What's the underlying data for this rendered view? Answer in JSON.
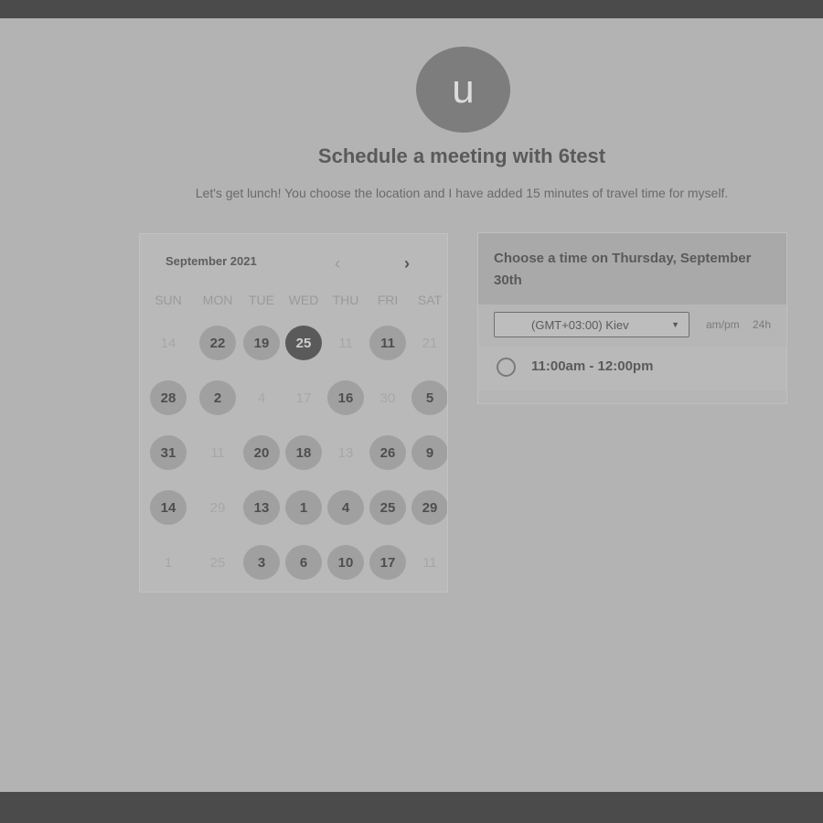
{
  "host": {
    "avatar_initial": "u",
    "title": "Schedule a meeting with 6test",
    "description": "Let's get lunch! You choose the location and I have added 15 minutes of travel time for myself."
  },
  "calendar": {
    "month_label": "September 2021",
    "prev_icon": "chevron-left-icon",
    "next_icon": "chevron-right-icon",
    "weekdays": [
      "SUN",
      "MON",
      "TUE",
      "WED",
      "THU",
      "FRI",
      "SAT"
    ],
    "weeks": [
      [
        {
          "label": "14",
          "state": "off"
        },
        {
          "label": "22",
          "state": "on"
        },
        {
          "label": "19",
          "state": "on"
        },
        {
          "label": "25",
          "state": "selected"
        },
        {
          "label": "11",
          "state": "off"
        },
        {
          "label": "11",
          "state": "on"
        },
        {
          "label": "21",
          "state": "off"
        }
      ],
      [
        {
          "label": "28",
          "state": "on"
        },
        {
          "label": "2",
          "state": "on"
        },
        {
          "label": "4",
          "state": "off"
        },
        {
          "label": "17",
          "state": "off"
        },
        {
          "label": "16",
          "state": "on"
        },
        {
          "label": "30",
          "state": "off"
        },
        {
          "label": "5",
          "state": "on"
        }
      ],
      [
        {
          "label": "31",
          "state": "on"
        },
        {
          "label": "11",
          "state": "off"
        },
        {
          "label": "20",
          "state": "on"
        },
        {
          "label": "18",
          "state": "on"
        },
        {
          "label": "13",
          "state": "off"
        },
        {
          "label": "26",
          "state": "on"
        },
        {
          "label": "9",
          "state": "on"
        }
      ],
      [
        {
          "label": "14",
          "state": "on"
        },
        {
          "label": "29",
          "state": "off"
        },
        {
          "label": "13",
          "state": "on"
        },
        {
          "label": "1",
          "state": "on"
        },
        {
          "label": "4",
          "state": "on"
        },
        {
          "label": "25",
          "state": "on"
        },
        {
          "label": "29",
          "state": "on"
        }
      ],
      [
        {
          "label": "1",
          "state": "off"
        },
        {
          "label": "25",
          "state": "off"
        },
        {
          "label": "3",
          "state": "on"
        },
        {
          "label": "6",
          "state": "on"
        },
        {
          "label": "10",
          "state": "on"
        },
        {
          "label": "17",
          "state": "on"
        },
        {
          "label": "11",
          "state": "off"
        }
      ]
    ]
  },
  "time_panel": {
    "heading": "Choose a time on Thursday, September 30th",
    "timezone": "(GMT+03:00) Kiev",
    "format_ampm": "am/pm",
    "format_24h": "24h",
    "slots": [
      {
        "label": "11:00am - 12:00pm"
      }
    ]
  },
  "colors": {
    "page_background": "#b3b3b3",
    "frame_bar": "#4b4b4b",
    "selected_day": "#5a5a5a",
    "available_day": "#a0a0a0"
  }
}
